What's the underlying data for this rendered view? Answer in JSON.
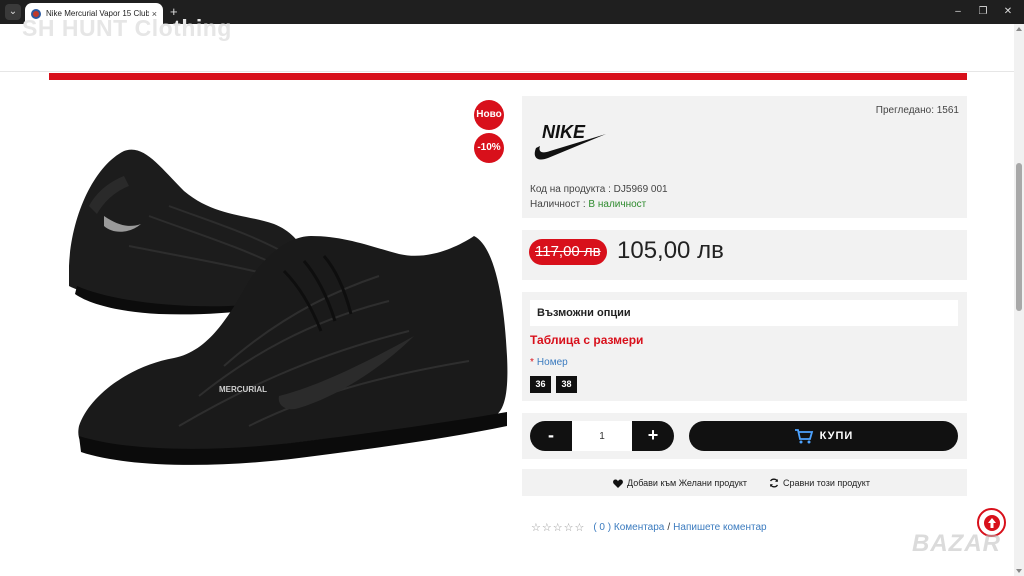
{
  "browser": {
    "tab_title": "Nike Mercurial Vapor 15 Club",
    "tab_close": "×",
    "new_tab": "+",
    "minimize": "–",
    "restore": "❐",
    "close": "✕",
    "tab_menu": "⌄"
  },
  "site": {
    "logo_text": "SH HUNT Clothing",
    "accent_color": "#d8101b"
  },
  "product": {
    "badges": {
      "new": "Ново",
      "discount": "-10%"
    },
    "views": "Прегледано: 1561",
    "brand": "NIKE",
    "code_label": "Код на продукта :",
    "code_value": "DJ5969 001",
    "stock_label": "Наличност :",
    "stock_value": "В наличност",
    "old_price": "117,00 лв",
    "new_price": "105,00 лв"
  },
  "options": {
    "heading": "Възможни опции",
    "size_chart": "Таблица с размери",
    "size_required": "*",
    "size_label": "Номер",
    "sizes": [
      "36",
      "38"
    ]
  },
  "cart": {
    "minus": "-",
    "plus": "+",
    "quantity": "1",
    "buy_label": "КУПИ"
  },
  "actions": {
    "wishlist": "Добави към Желани продукт",
    "compare": "Сравни този продукт"
  },
  "reviews": {
    "stars": "☆☆☆☆☆",
    "count": "( 0 ) Коментара",
    "separator": "/",
    "write": "Напишете коментар"
  },
  "watermark": "BAZAR"
}
